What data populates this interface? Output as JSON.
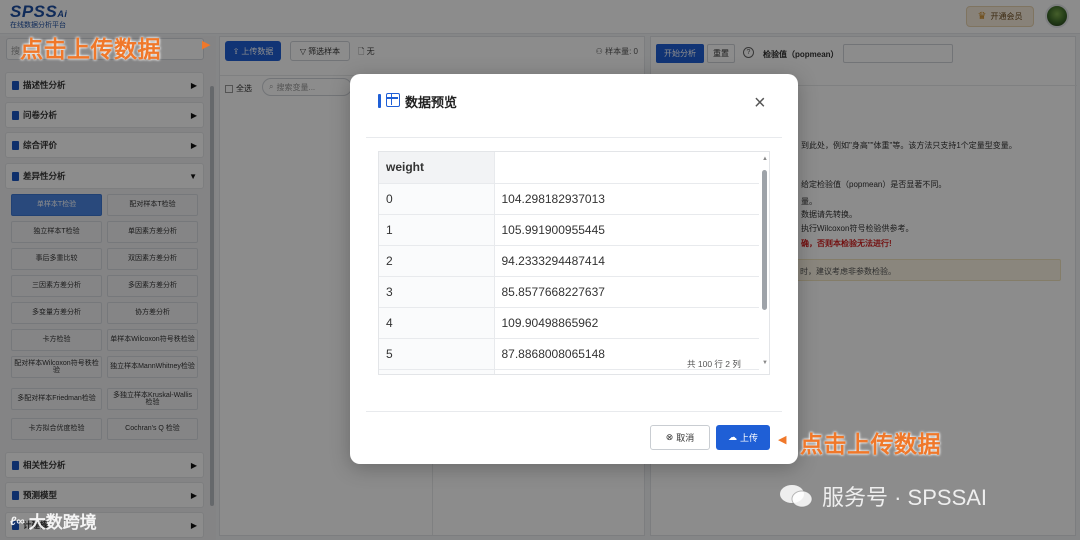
{
  "header": {
    "logo_main": "SPSS",
    "logo_sup": "Ai",
    "logo_sub": "在线数据分析平台",
    "vip_label": "开通会员"
  },
  "sidebar": {
    "search_placeholder": "搜",
    "categories": [
      {
        "label": "描述性分析"
      },
      {
        "label": "问卷分析"
      },
      {
        "label": "综合评价"
      },
      {
        "label": "差异性分析"
      },
      {
        "label": "相关性分析"
      },
      {
        "label": "预测模型"
      },
      {
        "label": "计建模"
      }
    ],
    "sub_items": [
      "单样本T检验",
      "配对样本T检验",
      "独立样本T检验",
      "单因素方差分析",
      "事后多重比较",
      "双因素方差分析",
      "三因素方差分析",
      "多因素方差分析",
      "多变量方差分析",
      "协方差分析",
      "卡方检验",
      "单样本Wilcoxon符号秩检验",
      "配对样本Wilcoxon符号秩检验",
      "独立样本MannWhitney检验",
      "多配对样本Friedman检验",
      "多独立样本Kruskal-Wallis检验",
      "卡方拟合优度检验",
      "Cochran's Q 检验"
    ]
  },
  "middle": {
    "upload_label": "上传数据",
    "filter_label": "筛选样本",
    "file_label": "无",
    "sample_label": "样本量:",
    "sample_value": "0",
    "select_all": "全选",
    "var_search_placeholder": "搜索变量..."
  },
  "right": {
    "start_label": "开始分析",
    "reset_label": "重置",
    "test_value_label": "检验值（popmean）",
    "lines": [
      "到此处，例如\"身高\"\"体重\"等。该方法只支持1个定量型变量。",
      "给定检验值（popmean）是否显著不同。",
      "量。",
      "数据请先转换。",
      "执行Wilcoxon符号检验供参考。",
      "确，否则本检验无法进行!"
    ],
    "note": "时，建议考虑非参数检验。"
  },
  "modal": {
    "title": "数据预览",
    "column_header": "weight",
    "rows": [
      {
        "index": "0",
        "value": "104.298182937013"
      },
      {
        "index": "1",
        "value": "105.991900955445"
      },
      {
        "index": "2",
        "value": "94.2333294487414"
      },
      {
        "index": "3",
        "value": "85.8577668227637"
      },
      {
        "index": "4",
        "value": "109.90498865962"
      },
      {
        "index": "5",
        "value": "87.8868008065148"
      }
    ],
    "table_info": "共 100 行 2 列",
    "cancel_label": "取消",
    "upload_label": "上传"
  },
  "annotations": {
    "top_left": "点击上传数据",
    "bottom_right": "点击上传数据"
  },
  "watermarks": {
    "right": "服务号 · SPSSAI",
    "left_mark": "ℓ∞",
    "left": "大数跨境"
  },
  "colors": {
    "primary": "#1f5fd6",
    "annotation": "#f0782a",
    "danger": "#d21f1f"
  }
}
